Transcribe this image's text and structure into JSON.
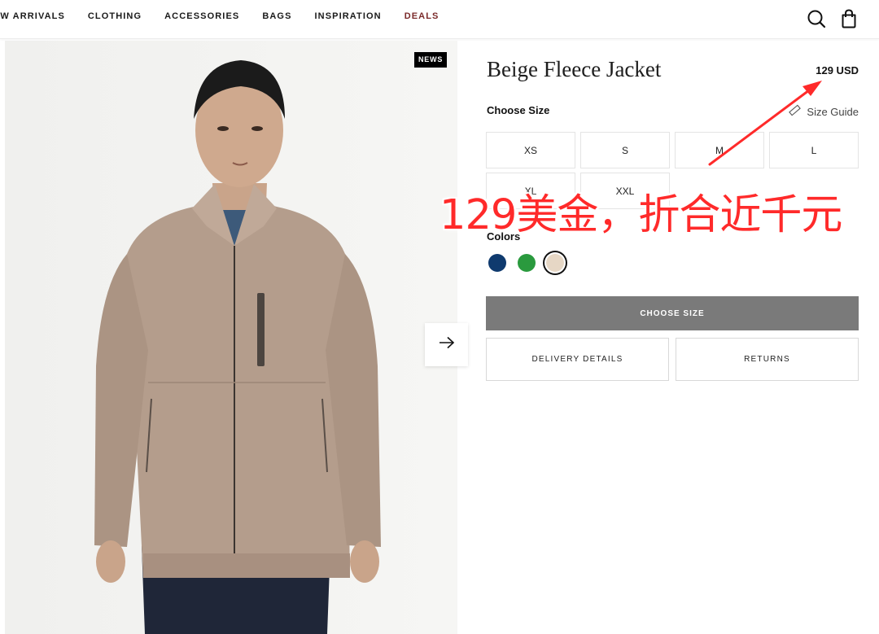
{
  "nav": {
    "items": [
      "EW ARRIVALS",
      "CLOTHING",
      "ACCESSORIES",
      "BAGS",
      "INSPIRATION",
      "DEALS"
    ]
  },
  "product": {
    "badge": "NEWS",
    "title": "Beige Fleece Jacket",
    "price": "129 USD",
    "choose_size_label": "Choose Size",
    "size_guide_label": "Size Guide",
    "sizes": [
      "XS",
      "S",
      "M",
      "L",
      "XL",
      "XXL"
    ],
    "colors_label": "Colors",
    "colors": [
      {
        "name": "navy",
        "hex": "#0f3a6e"
      },
      {
        "name": "green",
        "hex": "#2a9a3e"
      },
      {
        "name": "beige",
        "hex": "#e6d7c5",
        "selected": true
      }
    ],
    "choose_size_button": "CHOOSE SIZE",
    "delivery_button": "DELIVERY DETAILS",
    "returns_button": "RETURNS"
  },
  "annotation": {
    "text": "129美金，折合近千元",
    "color": "#ff2a2a"
  },
  "icons": {
    "search": "search-icon",
    "bag": "shopping-bag-icon",
    "next": "arrow-right-icon",
    "ruler": "ruler-icon"
  }
}
